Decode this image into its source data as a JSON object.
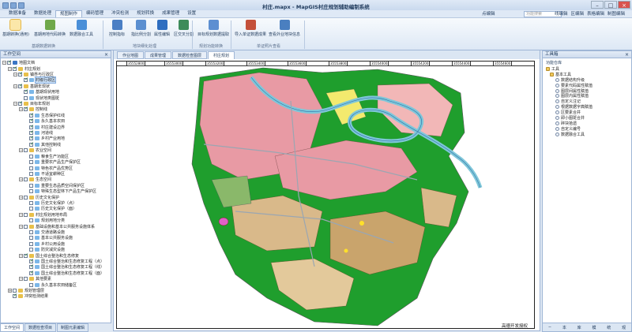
{
  "window": {
    "title": "村庄.mapx - MapGIS村庄规划辅助编制系统"
  },
  "menu": {
    "tabs": [
      "数据准备",
      "数据处理",
      "规图制作",
      "编码管理",
      "冲突检测",
      "规划转换",
      "成果管理",
      "设置"
    ],
    "active": "规图制作",
    "right_tabs": [
      "点编辑",
      "线编辑",
      "区编辑",
      "表格编辑",
      "制图编辑"
    ],
    "search_placeholder": "功能搜索"
  },
  "ribbon": {
    "buttons": [
      {
        "label": "基期转换(通用)",
        "color": "#3a7bd5"
      },
      {
        "label": "基期用地代码转换",
        "color": "#6fa84a"
      },
      {
        "label": "数据融合工具",
        "color": "#4a8fd8"
      },
      {
        "label": "控制指标",
        "color": "#4b7fc4"
      },
      {
        "label": "指比例分割",
        "color": "#5b8fd0"
      },
      {
        "label": "属性编辑",
        "color": "#2f6ec0"
      },
      {
        "label": "区交叉分割",
        "color": "#3d8b5a"
      },
      {
        "label": "目标规划数据提取",
        "color": "#5d8fd1"
      },
      {
        "label": "导入单证数据成果",
        "color": "#c4503a"
      },
      {
        "label": "查看外业地块信息",
        "color": "#4a7fc0"
      }
    ],
    "groups": [
      "基期数据转换",
      "地块细化处理",
      "规划功能转换",
      "单证照片查看"
    ]
  },
  "left_panel": {
    "title": "工作空间",
    "tree": [
      {
        "label": "地图文档",
        "level": 0,
        "exp": "−",
        "cb": true,
        "icon": "#3a76c4"
      },
      {
        "label": "村庄规划",
        "level": 1,
        "exp": "−",
        "cb": true,
        "icon": "#e8c04a"
      },
      {
        "label": "镇界与行政区",
        "level": 2,
        "exp": "−",
        "cb": true,
        "icon": "#e8c04a"
      },
      {
        "label": "村级行政区",
        "level": 3,
        "exp": "",
        "cb": true,
        "icon": "#7cb7e8",
        "sel": true
      },
      {
        "label": "基期年现状",
        "level": 2,
        "exp": "−",
        "cb": true,
        "icon": "#e8c04a"
      },
      {
        "label": "基期现状用地",
        "level": 3,
        "exp": "",
        "cb": true,
        "icon": "#7cb7e8"
      },
      {
        "label": "现状地类图斑",
        "level": 3,
        "exp": "",
        "cb": false,
        "icon": "#7cb7e8"
      },
      {
        "label": "目标年规划",
        "level": 2,
        "exp": "−",
        "cb": true,
        "icon": "#e8c04a"
      },
      {
        "label": "控制线",
        "level": 3,
        "exp": "−",
        "cb": true,
        "icon": "#e8c04a"
      },
      {
        "label": "生态保护红线",
        "level": 4,
        "exp": "",
        "cb": true,
        "icon": "#7cb7e8"
      },
      {
        "label": "永久基本农田",
        "level": 4,
        "exp": "",
        "cb": true,
        "icon": "#7cb7e8"
      },
      {
        "label": "村庄建设边界",
        "level": 4,
        "exp": "",
        "cb": true,
        "icon": "#7cb7e8"
      },
      {
        "label": "河道线",
        "level": 4,
        "exp": "",
        "cb": true,
        "icon": "#7cb7e8"
      },
      {
        "label": "乡村产业用地",
        "level": 4,
        "exp": "",
        "cb": true,
        "icon": "#7cb7e8"
      },
      {
        "label": "其他控制线",
        "level": 4,
        "exp": "",
        "cb": true,
        "icon": "#7cb7e8"
      },
      {
        "label": "农业空间",
        "level": 3,
        "exp": "−",
        "cb": false,
        "icon": "#e8c04a"
      },
      {
        "label": "粮食生产功能区",
        "level": 4,
        "exp": "",
        "cb": false,
        "icon": "#7cb7e8"
      },
      {
        "label": "重要农产品生产保护区",
        "level": 4,
        "exp": "",
        "cb": false,
        "icon": "#7cb7e8"
      },
      {
        "label": "特色农产品优势区",
        "level": 4,
        "exp": "",
        "cb": false,
        "icon": "#7cb7e8"
      },
      {
        "label": "不适宜耕种区",
        "level": 4,
        "exp": "",
        "cb": false,
        "icon": "#7cb7e8"
      },
      {
        "label": "生态空间",
        "level": 3,
        "exp": "−",
        "cb": false,
        "icon": "#e8c04a"
      },
      {
        "label": "重要生态品质空间保护区",
        "level": 4,
        "exp": "",
        "cb": false,
        "icon": "#7cb7e8"
      },
      {
        "label": "特殊生态型林下产品生产保护区",
        "level": 4,
        "exp": "",
        "cb": false,
        "icon": "#7cb7e8"
      },
      {
        "label": "历史文化保护",
        "level": 3,
        "exp": "−",
        "cb": false,
        "icon": "#e8c04a"
      },
      {
        "label": "历史文化保护（点）",
        "level": 4,
        "exp": "",
        "cb": false,
        "icon": "#7cb7e8"
      },
      {
        "label": "历史文化保护（面）",
        "level": 4,
        "exp": "",
        "cb": false,
        "icon": "#7cb7e8"
      },
      {
        "label": "村庄规划用地布局",
        "level": 3,
        "exp": "−",
        "cb": false,
        "icon": "#e8c04a"
      },
      {
        "label": "规划用地分类",
        "level": 4,
        "exp": "",
        "cb": false,
        "icon": "#7cb7e8"
      },
      {
        "label": "基础设施和基本公共服务设施体系",
        "level": 3,
        "exp": "−",
        "cb": false,
        "icon": "#e8c04a"
      },
      {
        "label": "交通道路设施",
        "level": 4,
        "exp": "",
        "cb": false,
        "icon": "#7cb7e8"
      },
      {
        "label": "基本公共服务设施",
        "level": 4,
        "exp": "",
        "cb": false,
        "icon": "#7cb7e8"
      },
      {
        "label": "乡村公用设施",
        "level": 4,
        "exp": "",
        "cb": false,
        "icon": "#7cb7e8"
      },
      {
        "label": "防灾减灾设施",
        "level": 4,
        "exp": "",
        "cb": false,
        "icon": "#7cb7e8"
      },
      {
        "label": "国土综合整治和生态修复",
        "level": 3,
        "exp": "−",
        "cb": true,
        "icon": "#e8c04a"
      },
      {
        "label": "国土综合整治和生态修复工程（点）",
        "level": 4,
        "exp": "",
        "cb": true,
        "icon": "#7cb7e8"
      },
      {
        "label": "国土综合整治和生态修复工程（线）",
        "level": 4,
        "exp": "",
        "cb": true,
        "icon": "#7cb7e8"
      },
      {
        "label": "国土综合整治和生态修复工程（面）",
        "level": 4,
        "exp": "",
        "cb": true,
        "icon": "#7cb7e8"
      },
      {
        "label": "其他要素",
        "level": 3,
        "exp": "−",
        "cb": false,
        "icon": "#e8c04a"
      },
      {
        "label": "永久基本农田储备区",
        "level": 4,
        "exp": "",
        "cb": false,
        "icon": "#7cb7e8"
      },
      {
        "label": "规划管理层",
        "level": 1,
        "exp": "+",
        "cb": false,
        "icon": "#e8c04a"
      },
      {
        "label": "冲突检测结果",
        "level": 1,
        "exp": "",
        "cb": true,
        "icon": "#e8c04a"
      }
    ],
    "bottom_tabs": [
      "工作空间",
      "数据检查项目",
      "制图元素编辑"
    ]
  },
  "map_tabs": {
    "tabs": [
      "作业地图",
      "成果管理",
      "数据检查图层",
      "村庄规划"
    ],
    "active": "村庄规划"
  },
  "ruler": [
    "35552800",
    "35553000",
    "35553200",
    "35553400",
    "35553600",
    "35553800",
    "35554000",
    "35554200",
    "35554400",
    "35554600"
  ],
  "map_footer": "高德开发授权",
  "right_panel": {
    "title": "工具箱",
    "sub": "功能仓库",
    "tree": [
      {
        "label": "工具",
        "folder": true
      },
      {
        "label": "基本工具",
        "folder": true
      },
      {
        "label": "数据结构升级",
        "folder": false
      },
      {
        "label": "要素代码属性赋值",
        "folder": false
      },
      {
        "label": "图层间属性赋值",
        "folder": false
      },
      {
        "label": "图层内属性赋值",
        "folder": false
      },
      {
        "label": "自定义注记",
        "folder": false
      },
      {
        "label": "根据数据字典赋值",
        "folder": false
      },
      {
        "label": "区要素合并",
        "folder": false
      },
      {
        "label": "即小图斑合并",
        "folder": false
      },
      {
        "label": "碎块拾遗",
        "folder": false
      },
      {
        "label": "自定义编号",
        "folder": false
      },
      {
        "label": "数据融合工具",
        "folder": false
      }
    ],
    "bottom_tools": [
      "−",
      "本",
      "库",
      "模",
      "统",
      "观"
    ]
  },
  "colors": {
    "accent": "#3a76c4",
    "pink_land": "#e89aa4",
    "green": "#1f9e2d",
    "tan": "#d9b98a",
    "water": "#7fc7d9"
  }
}
